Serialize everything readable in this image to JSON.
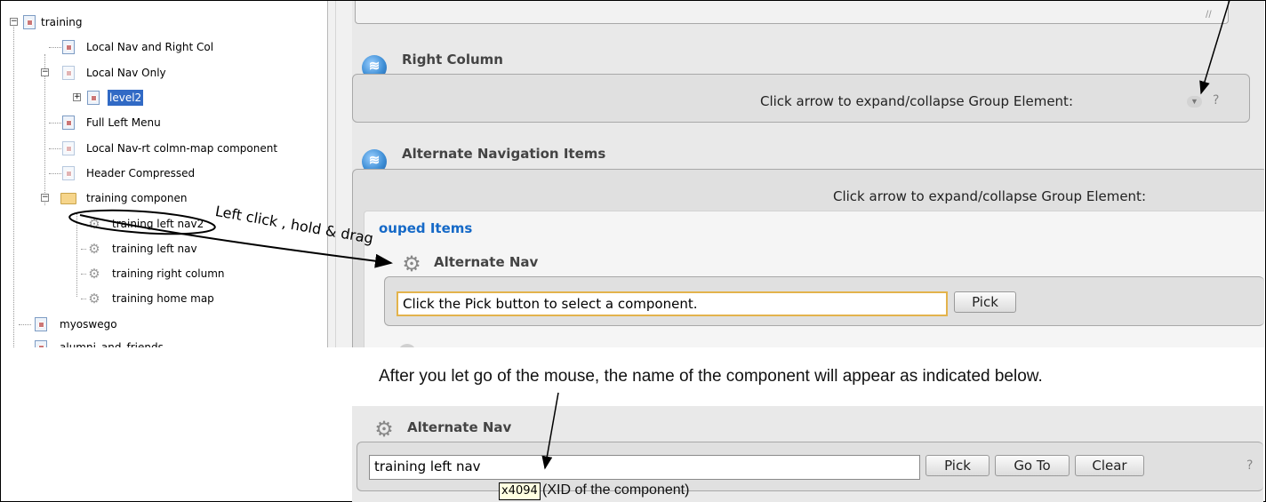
{
  "tree": {
    "items": [
      {
        "label": "training"
      },
      {
        "label": "Local Nav and  Right Col"
      },
      {
        "label": "Local Nav Only"
      },
      {
        "label": "level2"
      },
      {
        "label": "Full Left Menu"
      },
      {
        "label": "Local Nav-rt colmn-map component"
      },
      {
        "label": "Header Compressed"
      },
      {
        "label": "training componen"
      },
      {
        "label": "training left nav2"
      },
      {
        "label": "training left nav"
      },
      {
        "label": "training right column"
      },
      {
        "label": "training home map"
      },
      {
        "label": "myoswego"
      },
      {
        "label": "alumni_and_friends"
      }
    ]
  },
  "form": {
    "right_column": {
      "title": "Right Column",
      "hint": "Click arrow to expand/collapse Group Element:",
      "help": "?"
    },
    "alt_nav_items": {
      "title": "Alternate Navigation Items",
      "hint": "Click arrow to expand/collapse Group Element:"
    },
    "grouped_items": {
      "label": "ouped Items"
    },
    "alternate_nav": {
      "title": "Alternate Nav",
      "input_value": "Click the Pick button to select a component.",
      "pick_label": "Pick"
    }
  },
  "annotations": {
    "drag_hint": "Left click , hold & drag",
    "caption": "After you let go of the mouse, the name of the component will appear as indicated below."
  },
  "after": {
    "title": "Alternate Nav",
    "input_value": "training left nav",
    "pick_label": "Pick",
    "goto_label": "Go To",
    "clear_label": "Clear",
    "help": "?",
    "xid": "x4094",
    "xid_note": "(XID of the component)"
  }
}
